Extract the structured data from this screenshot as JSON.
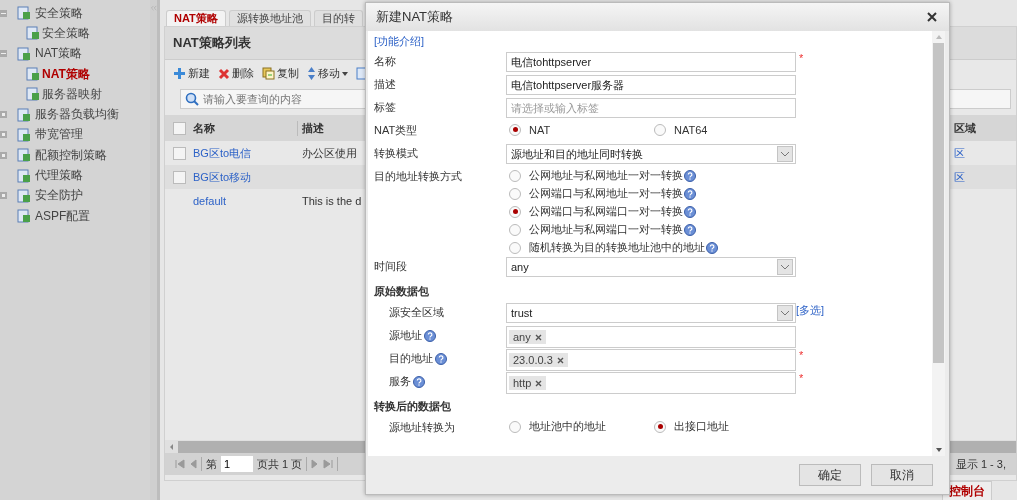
{
  "sidebar": {
    "items": [
      {
        "label": "安全策略",
        "expanded": true,
        "selected": false,
        "children": [
          {
            "label": "安全策略",
            "selected": false
          }
        ]
      },
      {
        "label": "NAT策略",
        "expanded": true,
        "selected": false,
        "children": [
          {
            "label": "NAT策略",
            "selected": true
          },
          {
            "label": "服务器映射",
            "selected": false
          }
        ]
      },
      {
        "label": "服务器负载均衡",
        "expanded": false,
        "selected": false
      },
      {
        "label": "带宽管理",
        "expanded": false,
        "selected": false
      },
      {
        "label": "配额控制策略",
        "expanded": false,
        "selected": false
      },
      {
        "label": "代理策略",
        "selected": false
      },
      {
        "label": "安全防护",
        "expanded": false,
        "selected": false
      },
      {
        "label": "ASPF配置",
        "selected": false
      }
    ]
  },
  "tabs": [
    {
      "label": "NAT策略",
      "selected": true
    },
    {
      "label": "源转换地址池",
      "selected": false
    },
    {
      "label": "目的转",
      "selected": false
    }
  ],
  "panel": {
    "title": "NAT策略列表",
    "toolbar": [
      {
        "kind": "add",
        "label": "新建"
      },
      {
        "kind": "delete",
        "label": "删除"
      },
      {
        "kind": "copy",
        "label": "复制"
      },
      {
        "kind": "move",
        "label": "移动",
        "dropdown": true
      },
      {
        "kind": "more"
      }
    ],
    "search": {
      "placeholder": "请输入要查询的内容"
    },
    "table": {
      "all_checked": false,
      "columns": [
        "名称",
        "描述",
        "区域"
      ],
      "rows": [
        {
          "kind": "checkable",
          "checked": false,
          "cells": [
            "BG区to电信",
            "办公区使用",
            "区"
          ]
        },
        {
          "kind": "checkable",
          "checked": false,
          "cells": [
            "BG区to移动",
            "",
            "区"
          ]
        },
        {
          "kind": "fixed",
          "cells": [
            "default",
            "This is the d",
            ""
          ]
        }
      ]
    },
    "pagination": {
      "prefix": "第",
      "page": "1",
      "suffix": "页共 1 页",
      "summary": "显示 1 - 3,"
    }
  },
  "console_tab": "控制台",
  "dialog": {
    "title": "新建NAT策略",
    "intro_link": "[功能介绍]",
    "fields": [
      {
        "kind": "text",
        "label": "名称",
        "value": "电信tohttpserver",
        "required_mark": "*"
      },
      {
        "kind": "text",
        "label": "描述",
        "value": "电信tohttpserver服务器"
      },
      {
        "kind": "text",
        "label": "标签",
        "placeholder": "请选择或输入标签"
      },
      {
        "kind": "radio",
        "label": "NAT类型",
        "options": [
          {
            "label": "NAT",
            "selected": true
          },
          {
            "label": "NAT64",
            "selected": false
          }
        ]
      },
      {
        "kind": "select",
        "label": "转换模式",
        "value": "源地址和目的地址同时转换"
      },
      {
        "kind": "radio_list",
        "label": "目的地址转换方式",
        "options": [
          {
            "label": "公网地址与私网地址一对一转换",
            "selected": false
          },
          {
            "label": "公网端口与私网地址一对一转换",
            "selected": false
          },
          {
            "label": "公网端口与私网端口一对一转换",
            "selected": true
          },
          {
            "label": "公网地址与私网端口一对一转换",
            "selected": false
          },
          {
            "label": "随机转换为目的转换地址池中的地址",
            "selected": false
          }
        ]
      },
      {
        "kind": "select",
        "label": "时间段",
        "value": "any"
      },
      {
        "kind": "section",
        "label": "原始数据包",
        "children": [
          {
            "kind": "select",
            "label": "源安全区域",
            "value": "trust",
            "link": "[多选]"
          },
          {
            "kind": "tags",
            "label": "源地址",
            "help": true,
            "tags": [
              "any"
            ]
          },
          {
            "kind": "tags",
            "label": "目的地址",
            "help": true,
            "tags": [
              "23.0.0.3"
            ],
            "required_mark": "*"
          },
          {
            "kind": "tags",
            "label": "服务",
            "help": true,
            "tags": [
              "http"
            ],
            "required_mark": "*"
          }
        ]
      },
      {
        "kind": "section",
        "label": "转换后的数据包",
        "children": [
          {
            "kind": "radio",
            "label": "源地址转换为",
            "options": [
              {
                "label": "地址池中的地址",
                "selected": false
              },
              {
                "label": "出接口地址",
                "selected": true
              }
            ]
          }
        ]
      }
    ],
    "buttons": [
      "确定",
      "取消"
    ]
  }
}
